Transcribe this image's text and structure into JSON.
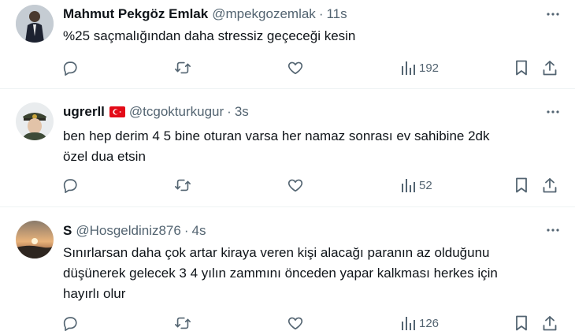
{
  "tweets": [
    {
      "name": "Mahmut Pekgöz Emlak",
      "handle": "@mpekgozemlak",
      "separator": "·",
      "time": "11s",
      "lines": [
        "%25 saçmalığından daha stressiz geçeceği kesin"
      ],
      "views": "192",
      "avatar_icon": "person-suit-avatar"
    },
    {
      "name": "ugrerll",
      "handle": "@tcgokturkugur",
      "separator": "·",
      "time": "3s",
      "flag_icon": "turkey-flag-emoji",
      "lines": [
        "ben hep derim 4 5 bine oturan varsa her namaz sonrası ev sahibine  2dk",
        "özel dua etsin"
      ],
      "views": "52",
      "avatar_icon": "officer-cap-avatar"
    },
    {
      "name": "S",
      "handle": "@Hosgeldiniz876",
      "separator": "·",
      "time": "4s",
      "lines": [
        "Sınırlarsan daha çok artar kiraya veren kişi alacağı paranın az olduğunu",
        "düşünerek gelecek 3 4 yılın zammını önceden yapar kalkması herkes için",
        "hayırlı olur"
      ],
      "views": "126",
      "avatar_icon": "sunset-avatar"
    }
  ],
  "icons": {
    "reply": "reply-icon",
    "retweet": "retweet-icon",
    "like": "heart-icon",
    "views": "bar-chart-icon",
    "bookmark": "bookmark-icon",
    "share": "share-icon",
    "more": "more-dots-icon"
  },
  "colors": {
    "text_primary": "#0f1419",
    "text_secondary": "#536471",
    "divider": "#eff3f4",
    "flag_red": "#e30a17"
  }
}
